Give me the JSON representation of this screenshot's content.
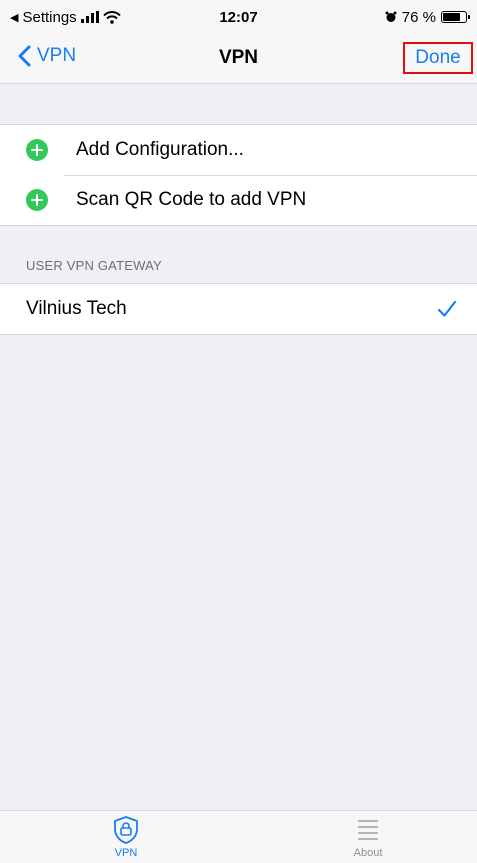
{
  "status_bar": {
    "back_app": "Settings",
    "time": "12:07",
    "battery": "76 %",
    "battery_level": 0.76
  },
  "nav": {
    "back_label": "VPN",
    "title": "VPN",
    "done_label": "Done"
  },
  "actions": [
    {
      "label": "Add Configuration..."
    },
    {
      "label": "Scan QR Code to add VPN"
    }
  ],
  "gateway_section": {
    "header": "USER VPN GATEWAY",
    "items": [
      {
        "label": "Vilnius Tech",
        "selected": true
      }
    ]
  },
  "tab_bar": {
    "tabs": [
      {
        "label": "VPN",
        "icon": "shield-lock-icon",
        "active": true
      },
      {
        "label": "About",
        "icon": "list-icon",
        "active": false
      }
    ]
  },
  "colors": {
    "accent": "#1a7cf5",
    "add_green": "#34c759",
    "highlight_red": "#e01010"
  }
}
